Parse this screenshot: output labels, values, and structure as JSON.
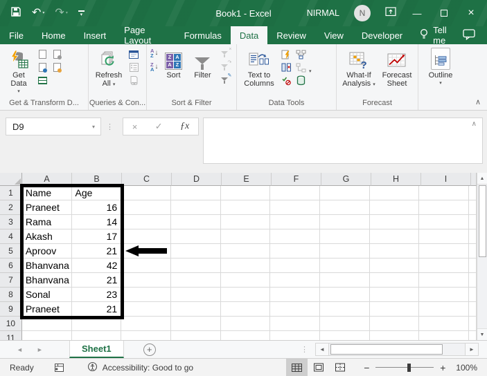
{
  "colors": {
    "excel_green": "#1e7145",
    "accent_green": "#217346",
    "annotation_black": "#000000"
  },
  "title_bar": {
    "title": "Book1 - Excel",
    "user": "NIRMAL",
    "avatar_initial": "N"
  },
  "menu": {
    "tabs": [
      "File",
      "Home",
      "Insert",
      "Page Layout",
      "Formulas",
      "Data",
      "Review",
      "View",
      "Developer"
    ],
    "active_tab": "Data",
    "tell_me": "Tell me"
  },
  "ribbon": {
    "get_data": "Get Data",
    "group1_label": "Get & Transform D...",
    "refresh_all_line1": "Refresh",
    "refresh_all_line2": "All",
    "group2_label": "Queries & Con...",
    "sort": "Sort",
    "filter": "Filter",
    "group3_label": "Sort & Filter",
    "text_to_columns_line1": "Text to",
    "text_to_columns_line2": "Columns",
    "group4_label": "Data Tools",
    "what_if_line1": "What-If",
    "what_if_line2": "Analysis",
    "forecast_sheet_line1": "Forecast",
    "forecast_sheet_line2": "Sheet",
    "group5_label": "Forecast",
    "outline": "Outline"
  },
  "formula_bar": {
    "name_box": "D9"
  },
  "grid": {
    "columns": [
      "A",
      "B",
      "C",
      "D",
      "E",
      "F",
      "G",
      "H",
      "I"
    ],
    "row_headers": [
      1,
      2,
      3,
      4,
      5,
      6,
      7,
      8,
      9,
      10,
      11
    ],
    "cells": [
      [
        "Name",
        "Age"
      ],
      [
        "Praneet",
        16
      ],
      [
        "Rama",
        14
      ],
      [
        "Akash",
        17
      ],
      [
        "Aproov",
        21
      ],
      [
        "Bhanvana",
        42
      ],
      [
        "Bhanvana",
        21
      ],
      [
        "Sonal",
        23
      ],
      [
        "Praneet",
        21
      ]
    ],
    "annotated_cell": "B5"
  },
  "sheet_bar": {
    "active_sheet": "Sheet1"
  },
  "status_bar": {
    "mode": "Ready",
    "accessibility": "Accessibility: Good to go",
    "zoom": "100%"
  },
  "icons": {
    "undo": "↶",
    "redo": "↷",
    "dropdown": "▾",
    "minimize": "—",
    "close": "×",
    "cancel": "×",
    "enter": "✓",
    "fx": "ƒx",
    "up": "▲",
    "down": "▼",
    "left": "◄",
    "right": "►",
    "dots": "⋮",
    "collapse": "∧",
    "plus": "+",
    "zoom_out": "−",
    "zoom_in": "+",
    "letter_a": "A",
    "letter_z": "Z",
    "sort_arrow": "↓"
  }
}
